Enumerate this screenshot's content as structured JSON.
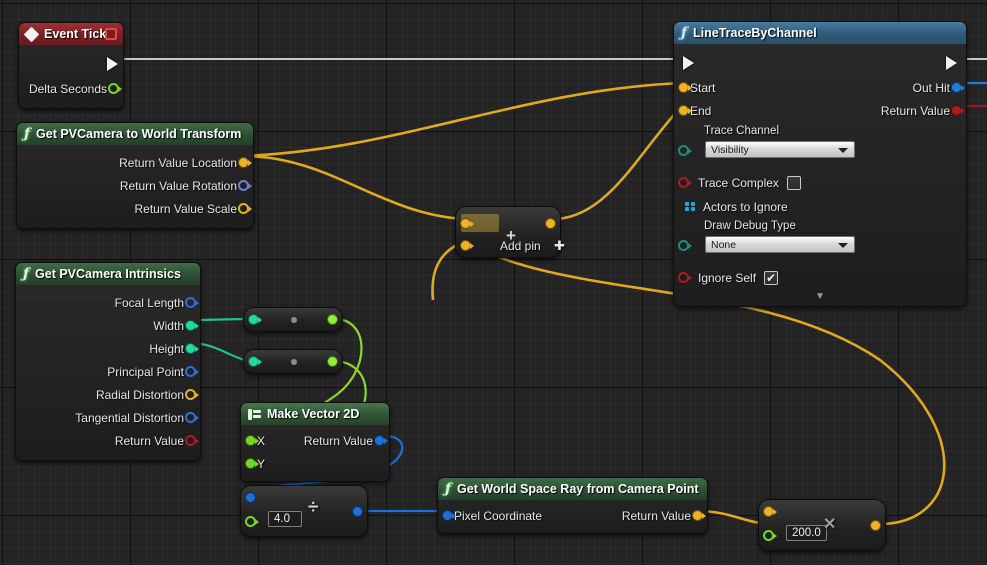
{
  "graph": {
    "app": "Unreal Engine Blueprint Event Graph",
    "background_color": "#242424",
    "grid_minor_color": "#2e2e2e",
    "grid_major_color": "#0a0a0a"
  },
  "wire_colors": {
    "exec": "#dcdcdc",
    "vector": "#f0b224",
    "float": "#8ef03a",
    "vector2d": "#2a7de0",
    "integer": "#22d6a8",
    "boolean": "#9a1f1f",
    "struct": "#3a6fd6"
  },
  "nodes": [
    {
      "id": "event-tick",
      "title": "Event Tick",
      "header_style": "red",
      "icon": "diamond-icon",
      "has_stop_button": true,
      "outputs": [
        {
          "label": "",
          "pin": "exec",
          "color": "#f2f2f2"
        },
        {
          "label": "Delta Seconds",
          "pin": "float-hollow",
          "color": "#73d926"
        }
      ]
    },
    {
      "id": "get-pvcamera-to-world-transform",
      "title": "Get PVCamera to World Transform",
      "header_style": "green",
      "icon": "function-icon",
      "outputs": [
        {
          "label": "Return Value Location",
          "pin": "vector-filled",
          "color": "#f0b224"
        },
        {
          "label": "Return Value Rotation",
          "pin": "rotator-hollow",
          "color": "#6d7fd6"
        },
        {
          "label": "Return Value Scale",
          "pin": "vector-hollow",
          "color": "#f0b224"
        }
      ]
    },
    {
      "id": "get-pvcamera-intrinsics",
      "title": "Get PVCamera Intrinsics",
      "header_style": "green",
      "icon": "function-icon",
      "outputs": [
        {
          "label": "Focal Length",
          "pin": "struct-hollow",
          "color": "#2f6fd4"
        },
        {
          "label": "Width",
          "pin": "int-filled",
          "color": "#24d8a6"
        },
        {
          "label": "Height",
          "pin": "int-filled",
          "color": "#24d8a6"
        },
        {
          "label": "Principal Point",
          "pin": "struct-hollow",
          "color": "#2f6fd4"
        },
        {
          "label": "Radial Distortion",
          "pin": "vector-hollow",
          "color": "#e8b01e"
        },
        {
          "label": "Tangential Distortion",
          "pin": "struct-hollow",
          "color": "#2f6fd4"
        },
        {
          "label": "Return Value",
          "pin": "bool-hollow",
          "color": "#a81d1d"
        }
      ]
    },
    {
      "id": "linetracebychannel",
      "title": "LineTraceByChannel",
      "header_style": "blue",
      "icon": "function-icon",
      "inputs": [
        {
          "label": "",
          "pin": "exec",
          "color": "#f2f2f2"
        },
        {
          "label": "Start",
          "pin": "vector-filled",
          "color": "#f0b224"
        },
        {
          "label": "End",
          "pin": "vector-filled",
          "color": "#f0b224"
        },
        {
          "label": "Trace Channel",
          "pin": "enum-hollow",
          "color": "#1c8f7e",
          "widget": "combo",
          "value": "Visibility"
        },
        {
          "label": "Trace Complex",
          "pin": "bool-hollow",
          "color": "#a81d1d",
          "widget": "checkbox",
          "checked": false
        },
        {
          "label": "Actors to Ignore",
          "pin": "array",
          "color": "#1fa8e0"
        },
        {
          "label": "Draw Debug Type",
          "pin": "enum-hollow",
          "color": "#1c8f7e",
          "widget": "combo",
          "value": "None"
        },
        {
          "label": "Ignore Self",
          "pin": "bool-hollow",
          "color": "#a81d1d",
          "widget": "checkbox",
          "checked": true
        }
      ],
      "outputs": [
        {
          "label": "",
          "pin": "exec",
          "color": "#f2f2f2"
        },
        {
          "label": "Out Hit",
          "pin": "struct-filled",
          "color": "#1f7fd6"
        },
        {
          "label": "Return Value",
          "pin": "bool-filled",
          "color": "#a81d1d"
        }
      ],
      "expander": "▼"
    },
    {
      "id": "add-vector",
      "title": "",
      "operator": "+",
      "add_pin_label": "Add pin",
      "add_pin_glyph": "✚",
      "inputs": [
        {
          "label": "",
          "pin": "vector-filled",
          "color": "#f0b224",
          "hovered": true
        },
        {
          "label": "",
          "pin": "vector-filled",
          "color": "#f0b224"
        }
      ],
      "outputs": [
        {
          "label": "",
          "pin": "vector-filled",
          "color": "#f0b224"
        }
      ]
    },
    {
      "id": "convert-width",
      "title": "",
      "operator": "",
      "inputs": [
        {
          "label": "",
          "pin": "int-filled",
          "color": "#24d8a6"
        }
      ],
      "outputs": [
        {
          "label": "",
          "pin": "float-filled",
          "color": "#8ef03a"
        }
      ]
    },
    {
      "id": "convert-height",
      "title": "",
      "operator": "",
      "inputs": [
        {
          "label": "",
          "pin": "int-filled",
          "color": "#24d8a6"
        }
      ],
      "outputs": [
        {
          "label": "",
          "pin": "float-filled",
          "color": "#8ef03a"
        }
      ]
    },
    {
      "id": "make-vector-2d",
      "title": "Make Vector 2D",
      "header_style": "green",
      "icon": "make-struct-icon",
      "inputs": [
        {
          "label": "X",
          "pin": "float-filled",
          "color": "#73d926"
        },
        {
          "label": "Y",
          "pin": "float-filled",
          "color": "#73d926"
        }
      ],
      "outputs": [
        {
          "label": "Return Value",
          "pin": "vector2d-filled",
          "color": "#1f6fd6"
        }
      ]
    },
    {
      "id": "divide-node",
      "title": "",
      "operator": "÷",
      "inputs": [
        {
          "label": "",
          "pin": "vector2d-filled",
          "color": "#1f6fd6"
        },
        {
          "label": "",
          "pin": "float-hollow",
          "color": "#73d926",
          "widget": "value",
          "value": "4.0"
        }
      ],
      "outputs": [
        {
          "label": "",
          "pin": "vector2d-filled",
          "color": "#1f6fd6"
        }
      ]
    },
    {
      "id": "get-world-space-ray-from-camera-point",
      "title": "Get World Space Ray from Camera Point",
      "header_style": "green",
      "icon": "function-icon",
      "inputs": [
        {
          "label": "Pixel Coordinate",
          "pin": "vector2d-filled",
          "color": "#1f6fd6"
        }
      ],
      "outputs": [
        {
          "label": "Return Value",
          "pin": "vector-filled",
          "color": "#f0b224"
        }
      ]
    },
    {
      "id": "multiply-node",
      "title": "",
      "operator": "✕",
      "inputs": [
        {
          "label": "",
          "pin": "vector-filled",
          "color": "#f0b224"
        },
        {
          "label": "",
          "pin": "float-hollow",
          "color": "#73d926",
          "widget": "value",
          "value": "200.0"
        }
      ],
      "outputs": [
        {
          "label": "",
          "pin": "vector-filled",
          "color": "#f0b224"
        }
      ]
    }
  ]
}
